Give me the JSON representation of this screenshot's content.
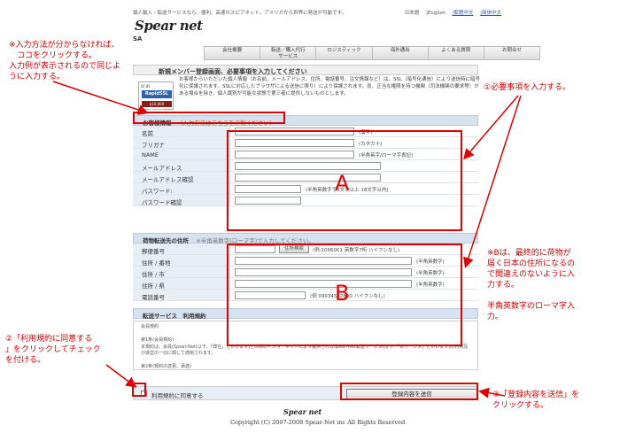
{
  "site": {
    "topline": "個人輸入・転送サービスなら、便利、高速のスピアネット。アメリカから世界に発送が可能です。",
    "languages": [
      "日本語",
      "|English",
      "|繁體中文",
      "|简体中文"
    ],
    "logo": "Spear net",
    "logo_sub": "SA"
  },
  "nav": {
    "items": [
      "会社概要",
      "転送／購入代行\nサービス",
      "ロジスティック",
      "海外通出",
      "よくある質問",
      "お問合せ"
    ]
  },
  "subhead": "新規メンバー登録画面、必要事項を入力してください",
  "ssl": {
    "line1": "ID BY",
    "line2": "RapidSSL",
    "line3": "$10,000 Warranty"
  },
  "intro": "お客様からいただいた個人情報（お名前、メールアドレス、住所、電話番号、注文情報など）は、SSL（暗号化通信）により送信時に暗号化に保護されます。SSLに対応したブラウザによる送信に限り）により保護されます。尚、正当な権限を持つ機関（司法機関の要求等）がある場合を除き、個人識別が可能な状態で第三者に提供しないものとします。",
  "customer_section": {
    "title": "お客様情報",
    "help_link": "（入力方法はこちらをご覧ください）",
    "fields": [
      {
        "label": "名前",
        "hint": "(漢字)"
      },
      {
        "label": "フリガナ",
        "hint": "(カタカナ)"
      },
      {
        "label": "NAME",
        "hint": "(半角英字/ローマ字表記)"
      },
      {
        "label": "メールアドレス",
        "hint": ""
      },
      {
        "label": "メールアドレス確認",
        "hint": ""
      },
      {
        "label": "パスワード:",
        "hint": "(半角英数字で5文字以上 18文字以内)"
      },
      {
        "label": "パスワード確認",
        "hint": ""
      }
    ]
  },
  "address_section": {
    "title": "荷物転送先の住所",
    "note": "※半角英数字(ローマ字)で入力してください。",
    "zip_button": "住所検索",
    "fields": [
      {
        "label": "郵便番号",
        "hint": "(例:1006001 英数字7桁 ハイフンなし)"
      },
      {
        "label": "住所 / 番地",
        "hint": "(半角英数字)"
      },
      {
        "label": "住所 / 市",
        "hint": "(半角英数字)"
      },
      {
        "label": "住所 / 県",
        "hint": "(半角英数字)"
      },
      {
        "label": "電話番号",
        "hint": "(例 09034567890 ハイフンなし)"
      }
    ]
  },
  "terms_section": {
    "title": "転送サービス　利用規約",
    "text": "会員規約\n\n第1条(会員規約)\n本規約は、会員(Spear-Net(以下、「弊社」といいます)との間のインターネットにより提供されるSpear-Net転送サービス(以下、「本サービス」といいます)の利用及び運営の一切に関して適用されます。\n\n第2条(規約の変更、承諾)"
  },
  "agree": {
    "label": "利用規約に同意する"
  },
  "submit": {
    "label": "登録内容を送信"
  },
  "footer": {
    "logo": "Spear net",
    "copyright": "Copyright (C) 2007-2008 Spear-Net inc  All Rights Reserved"
  },
  "annotations": {
    "note_help": "※入力方法が分からなければ、\n　ココをクリックする。\n入力例が表示されるので同じよ\nうに入力する。",
    "step1": "①必要事項を入力する。",
    "step2": "②「利用規約に同意する\n」をクリックしてチェック\nを付ける。",
    "step3": "③「登録内容を送信」を\nクリックする。",
    "note_b": "※Bは、最終的に荷物が\n届く日本の住所になるの\nで間違えのないように入\n力する。\n\n半角英数字のローマ字入\n力。",
    "label_a": "A",
    "label_b": "B",
    "color": "#e00000"
  }
}
